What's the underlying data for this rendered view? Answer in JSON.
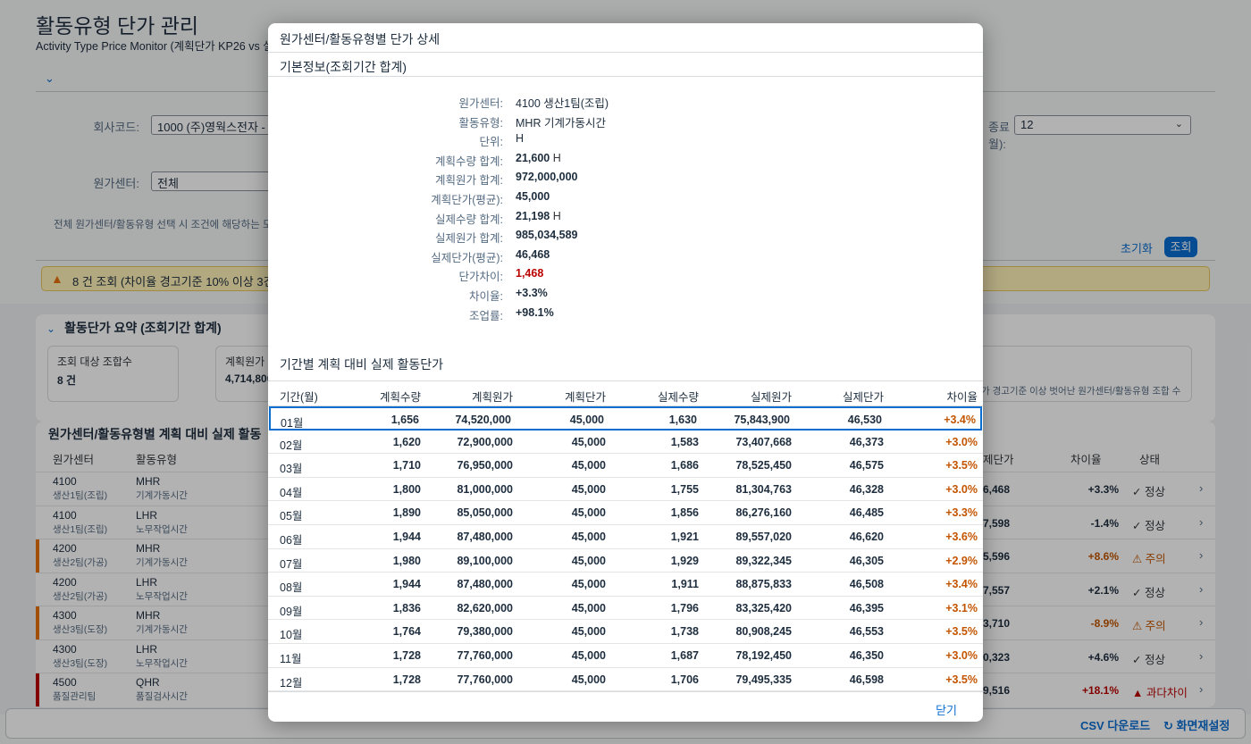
{
  "page": {
    "title": "활동유형 단가 관리",
    "subtitle": "Activity Type Price Monitor (계획단가 KP26 vs 실제"
  },
  "filters": {
    "company_label": "회사코드:",
    "company_value": "1000 (주)영웍스전자 - 한",
    "cost_center_label": "원가센터:",
    "cost_center_value": "전체",
    "end_period_label_1": "종료",
    "end_period_label_2": "월):",
    "end_period_value": "12",
    "hint": "전체 원가센터/활동유형 선택 시 조건에 해당하는 모든",
    "reset_label": "초기화",
    "search_label": "조회"
  },
  "status_strip": {
    "text": "8 건 조회 (차이율 경고기준 10% 이상 3건"
  },
  "summary": {
    "title": "활동단가 요약 (조회기간 합계)",
    "cards": [
      {
        "label": "조회 대상 조합수",
        "value": "8 건"
      },
      {
        "label": "계획원가",
        "value": "4,714,800"
      }
    ],
    "right_text": "가 경고기준 이상 벗어난 원가센터/활동유형 조합 수"
  },
  "main_table": {
    "title": "원가센터/활동유형별 계획 대비 실제 활동",
    "headers": {
      "cost_center": "원가센터",
      "activity": "활동유형",
      "actual_price": "제단가",
      "variance": "차이율",
      "status": "상태"
    },
    "rows": [
      {
        "cc": "4100",
        "cc_name": "생산1팀(조립)",
        "at": "MHR",
        "at_name": "기계가동시간",
        "price": "6,468",
        "var": "+3.3%",
        "status": "✓ 정상",
        "level": "normal"
      },
      {
        "cc": "4100",
        "cc_name": "생산1팀(조립)",
        "at": "LHR",
        "at_name": "노무작업시간",
        "price": "7,598",
        "var": "-1.4%",
        "status": "✓ 정상",
        "level": "normal"
      },
      {
        "cc": "4200",
        "cc_name": "생산2팀(가공)",
        "at": "MHR",
        "at_name": "기계가동시간",
        "price": "5,596",
        "var": "+8.6%",
        "status": "⚠ 주의",
        "level": "warn"
      },
      {
        "cc": "4200",
        "cc_name": "생산2팀(가공)",
        "at": "LHR",
        "at_name": "노무작업시간",
        "price": "7,557",
        "var": "+2.1%",
        "status": "✓ 정상",
        "level": "normal"
      },
      {
        "cc": "4300",
        "cc_name": "생산3팀(도장)",
        "at": "MHR",
        "at_name": "기계가동시간",
        "price": "3,710",
        "var": "-8.9%",
        "status": "⚠ 주의",
        "level": "warn"
      },
      {
        "cc": "4300",
        "cc_name": "생산3팀(도장)",
        "at": "LHR",
        "at_name": "노무작업시간",
        "price": "0,323",
        "var": "+4.6%",
        "status": "✓ 정상",
        "level": "normal"
      },
      {
        "cc": "4500",
        "cc_name": "품질관리팀",
        "at": "QHR",
        "at_name": "품질검사시간",
        "price": "9,516",
        "var": "+18.1%",
        "status": "▲ 과다차이",
        "level": "error"
      }
    ]
  },
  "footer": {
    "csv_label": "CSV 다운로드",
    "reset_view_label": "화면재설정"
  },
  "colors": {
    "accent": "#0a6ed1",
    "warning": "#e9730c",
    "error": "#bb0000",
    "variance_text": "#c35500"
  },
  "dialog": {
    "title": "원가센터/활동유형별 단가 상세",
    "section_basic": "기본정보(조회기간 합계)",
    "info": [
      {
        "label": "원가센터:",
        "value": "4100 생산1팀(조립)",
        "style": "plain",
        "unit": ""
      },
      {
        "label": "활동유형:",
        "value": "MHR 기계가동시간",
        "style": "plain",
        "unit": ""
      },
      {
        "label": "단위:",
        "value": "H",
        "style": "plain",
        "unit": ""
      },
      {
        "label": "계획수량 합계:",
        "value": "21,600",
        "style": "b",
        "unit": "H"
      },
      {
        "label": "계획원가 합계:",
        "value": "972,000,000",
        "style": "b",
        "unit": ""
      },
      {
        "label": "계획단가(평균):",
        "value": "45,000",
        "style": "b",
        "unit": ""
      },
      {
        "label": "실제수량 합계:",
        "value": "21,198",
        "style": "b",
        "unit": "H"
      },
      {
        "label": "실제원가 합계:",
        "value": "985,034,589",
        "style": "b",
        "unit": ""
      },
      {
        "label": "실제단가(평균):",
        "value": "46,468",
        "style": "b",
        "unit": ""
      },
      {
        "label": "단가차이:",
        "value": "1,468",
        "style": "red",
        "unit": ""
      },
      {
        "label": "차이율:",
        "value": "+3.3%",
        "style": "b",
        "unit": ""
      },
      {
        "label": "조업률:",
        "value": "+98.1%",
        "style": "b",
        "unit": ""
      }
    ],
    "section_period": "기간별 계획 대비 실제 활동단가",
    "grid_headers": [
      "기간(월)",
      "계획수량",
      "계획원가",
      "계획단가",
      "실제수량",
      "실제원가",
      "실제단가",
      "차이율"
    ],
    "grid_rows": [
      [
        "01월",
        "1,656",
        "74,520,000",
        "45,000",
        "1,630",
        "75,843,900",
        "46,530",
        "+3.4%"
      ],
      [
        "02월",
        "1,620",
        "72,900,000",
        "45,000",
        "1,583",
        "73,407,668",
        "46,373",
        "+3.0%"
      ],
      [
        "03월",
        "1,710",
        "76,950,000",
        "45,000",
        "1,686",
        "78,525,450",
        "46,575",
        "+3.5%"
      ],
      [
        "04월",
        "1,800",
        "81,000,000",
        "45,000",
        "1,755",
        "81,304,763",
        "46,328",
        "+3.0%"
      ],
      [
        "05월",
        "1,890",
        "85,050,000",
        "45,000",
        "1,856",
        "86,276,160",
        "46,485",
        "+3.3%"
      ],
      [
        "06월",
        "1,944",
        "87,480,000",
        "45,000",
        "1,921",
        "89,557,020",
        "46,620",
        "+3.6%"
      ],
      [
        "07월",
        "1,980",
        "89,100,000",
        "45,000",
        "1,929",
        "89,322,345",
        "46,305",
        "+2.9%"
      ],
      [
        "08월",
        "1,944",
        "87,480,000",
        "45,000",
        "1,911",
        "88,875,833",
        "46,508",
        "+3.4%"
      ],
      [
        "09월",
        "1,836",
        "82,620,000",
        "45,000",
        "1,796",
        "83,325,420",
        "46,395",
        "+3.1%"
      ],
      [
        "10월",
        "1,764",
        "79,380,000",
        "45,000",
        "1,738",
        "80,908,245",
        "46,553",
        "+3.5%"
      ],
      [
        "11월",
        "1,728",
        "77,760,000",
        "45,000",
        "1,687",
        "78,192,450",
        "46,350",
        "+3.0%"
      ],
      [
        "12월",
        "1,728",
        "77,760,000",
        "45,000",
        "1,706",
        "79,495,335",
        "46,598",
        "+3.5%"
      ]
    ],
    "close_label": "닫기"
  }
}
